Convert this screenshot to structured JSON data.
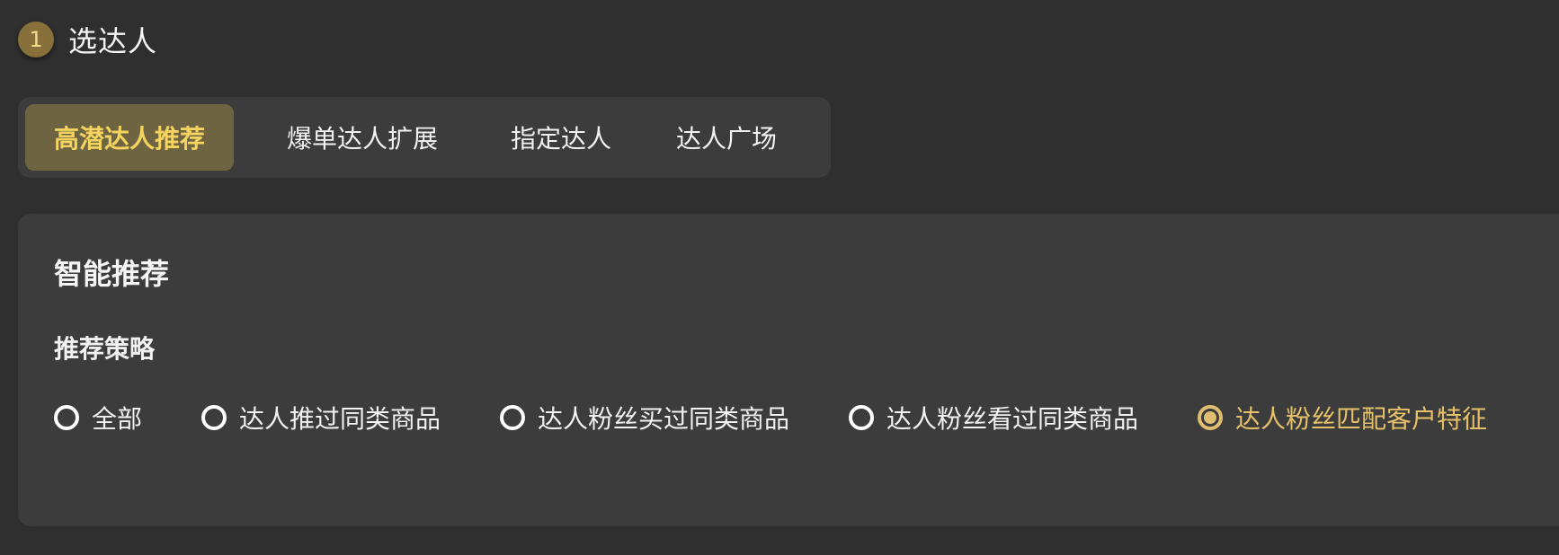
{
  "step": {
    "number": "1",
    "title": "选达人"
  },
  "tabs": [
    {
      "label": "高潜达人推荐",
      "active": true
    },
    {
      "label": "爆单达人扩展",
      "active": false
    },
    {
      "label": "指定达人",
      "active": false
    },
    {
      "label": "达人广场",
      "active": false
    }
  ],
  "card": {
    "title": "智能推荐",
    "strategy_label": "推荐策略",
    "options": [
      {
        "label": "全部",
        "selected": false
      },
      {
        "label": "达人推过同类商品",
        "selected": false
      },
      {
        "label": "达人粉丝买过同类商品",
        "selected": false
      },
      {
        "label": "达人粉丝看过同类商品",
        "selected": false
      },
      {
        "label": "达人粉丝匹配客户特征",
        "selected": true
      }
    ]
  },
  "colors": {
    "background": "#2f2f2f",
    "panel": "#3c3c3c",
    "accent_gold": "#f4d35f",
    "active_tab_bg": "#6e6442",
    "selected_radio": "#e0c070"
  }
}
